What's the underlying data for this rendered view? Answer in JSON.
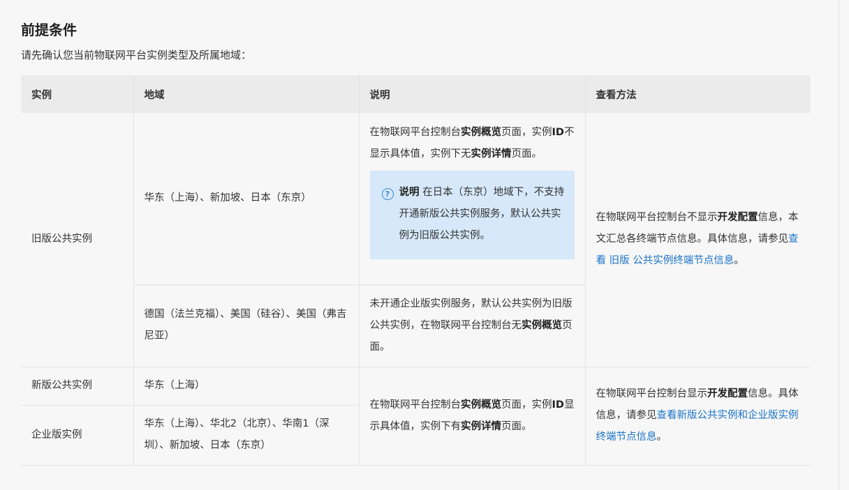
{
  "section": {
    "title": "前提条件",
    "intro": "请先确认您当前物联网平台实例类型及所属地域："
  },
  "table": {
    "headers": [
      "实例",
      "地域",
      "说明",
      "查看方法"
    ],
    "row1": {
      "instance": "旧版公共实例",
      "region_a": "华东（上海）、新加坡、日本（东京）",
      "desc_a": {
        "p1": "在物联网平台控制台",
        "b1": "实例概览",
        "p2": "页面，实例",
        "b2": "ID",
        "p3": "不显示具体值，实例下无",
        "b3": "实例详情",
        "p4": "页面。"
      },
      "note": {
        "label": "说明",
        "text": " 在日本（东京）地域下，不支持开通新版公共实例服务，默认公共实例为旧版公共实例。"
      },
      "region_b": "德国（法兰克福）、美国（硅谷）、美国（弗吉尼亚）",
      "desc_b": {
        "p1": "未开通企业版实例服务，默认公共实例为旧版公共实例，在物联网平台控制台无",
        "b1": "实例概览",
        "p2": "页面。"
      },
      "method": {
        "p1": "在物联网平台控制台不显示",
        "b1": "开发配置",
        "p2": "信息，本文汇总各终端节点信息。具体信息，请参见",
        "link": "查看 旧版 公共实例终端节点信息",
        "p3": "。"
      }
    },
    "row2": {
      "instance_new": "新版公共实例",
      "region_new": "华东（上海）",
      "instance_ent": "企业版实例",
      "region_ent": "华东（上海）、华北2（北京）、华南1（深圳）、新加坡、日本（东京）",
      "desc": {
        "p1": "在物联网平台控制台",
        "b1": "实例概览",
        "p2": "页面，实例",
        "b2": "ID",
        "p3": "显示具体值，实例下有",
        "b3": "实例详情",
        "p4": "页面。"
      },
      "method": {
        "p1": "在物联网平台控制台显示",
        "b1": "开发配置",
        "p2": "信息。具体信息，请参见",
        "link": "查看新版公共实例和企业版实例终端节点信息",
        "p3": "。"
      }
    }
  },
  "colors": {
    "link": "#1a73c8",
    "note_bg": "#d6e8f9",
    "header_bg": "#ebebeb"
  }
}
